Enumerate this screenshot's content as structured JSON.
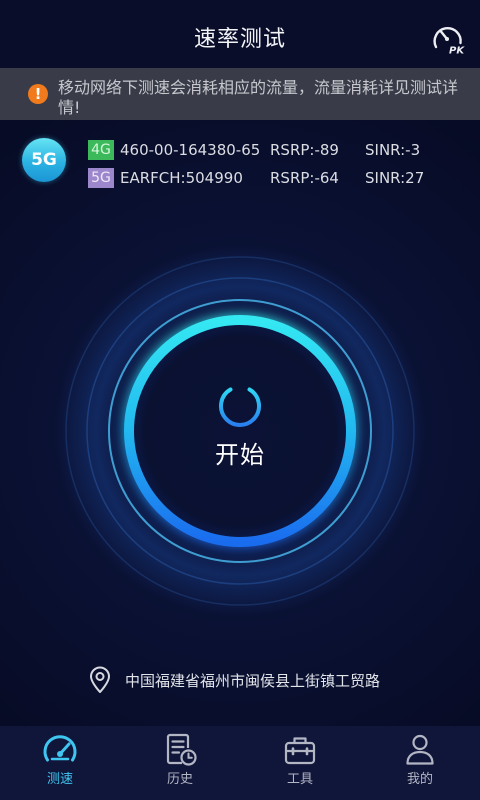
{
  "header": {
    "title": "速率测试",
    "pk_icon": "speedometer-pk-icon",
    "pk_label": "PK"
  },
  "notice": {
    "icon": "warning-icon",
    "icon_glyph": "!",
    "text": "移动网络下测速会消耗相应的流量，流量消耗详见测试详情!"
  },
  "network": {
    "badge": "5G",
    "rows": [
      {
        "tag": "4G",
        "cell": "460-00-164380-65",
        "rsrp": "RSRP:-89",
        "sinr": "SINR:-3"
      },
      {
        "tag": "5G",
        "cell": "EARFCH:504990",
        "rsrp": "RSRP:-64",
        "sinr": "SINR:27"
      }
    ]
  },
  "start": {
    "icon": "power-icon",
    "label": "开始"
  },
  "location": {
    "icon": "location-pin-icon",
    "text": "中国福建省福州市闽侯县上街镇工贸路"
  },
  "tabs": [
    {
      "label": "测速",
      "icon": "speedometer-icon",
      "active": true
    },
    {
      "label": "历史",
      "icon": "history-document-icon",
      "active": false
    },
    {
      "label": "工具",
      "icon": "toolbox-icon",
      "active": false
    },
    {
      "label": "我的",
      "icon": "person-icon",
      "active": false
    }
  ],
  "colors": {
    "background": "#070b25",
    "accent": "#3fc6f0",
    "tag_4g": "#3cb95a",
    "tag_5g": "#9c86cc",
    "warning": "#f07a1c",
    "tab_inactive": "#b3b6c3"
  }
}
